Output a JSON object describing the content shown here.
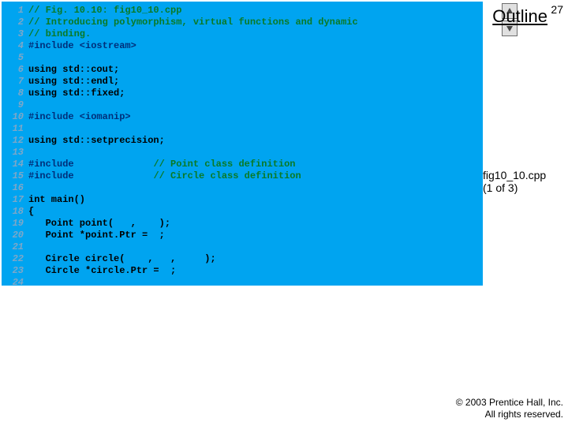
{
  "page_number": "27",
  "outline_label": "Outline",
  "nav": {
    "up_name": "up-arrow-icon",
    "down_name": "down-arrow-icon"
  },
  "code": {
    "lines": [
      {
        "n": "1",
        "cls": "comment",
        "text": "// Fig. 10.10: fig10_10.cpp"
      },
      {
        "n": "2",
        "cls": "comment",
        "text": "// Introducing polymorphism, virtual functions and dynamic"
      },
      {
        "n": "3",
        "cls": "comment",
        "text": "// binding."
      },
      {
        "n": "4",
        "cls": "preproc",
        "text": "#include <iostream>"
      },
      {
        "n": "5",
        "cls": "plain",
        "text": ""
      },
      {
        "n": "6",
        "cls": "plain",
        "text": "using std::cout;"
      },
      {
        "n": "7",
        "cls": "plain",
        "text": "using std::endl;"
      },
      {
        "n": "8",
        "cls": "plain",
        "text": "using std::fixed;"
      },
      {
        "n": "9",
        "cls": "plain",
        "text": ""
      },
      {
        "n": "10",
        "cls": "preproc",
        "text": "#include <iomanip>"
      },
      {
        "n": "11",
        "cls": "plain",
        "text": ""
      },
      {
        "n": "12",
        "cls": "plain",
        "text": "using std::setprecision;"
      },
      {
        "n": "13",
        "cls": "plain",
        "text": ""
      },
      {
        "n": "14",
        "cls": "preproc",
        "text": "#include              ",
        "comment_tail": "// Point class definition"
      },
      {
        "n": "15",
        "cls": "preproc",
        "text": "#include              ",
        "comment_tail": "// Circle class definition"
      },
      {
        "n": "16",
        "cls": "plain",
        "text": ""
      },
      {
        "n": "17",
        "cls": "plain",
        "text": "int main()"
      },
      {
        "n": "18",
        "cls": "plain",
        "text": "{"
      },
      {
        "n": "19",
        "cls": "plain",
        "text": "   Point point(   ,    );"
      },
      {
        "n": "20",
        "cls": "plain",
        "text": "   Point *point.Ptr =  ;"
      },
      {
        "n": "21",
        "cls": "plain",
        "text": ""
      },
      {
        "n": "22",
        "cls": "plain",
        "text": "   Circle circle(    ,   ,     );"
      },
      {
        "n": "23",
        "cls": "plain",
        "text": "   Circle *circle.Ptr =  ;"
      },
      {
        "n": "24",
        "cls": "plain",
        "text": ""
      }
    ]
  },
  "caption": {
    "line1": "fig10_10.cpp",
    "line2": "(1 of 3)"
  },
  "copyright": {
    "line1": "© 2003 Prentice Hall, Inc.",
    "line2": "All rights reserved."
  }
}
